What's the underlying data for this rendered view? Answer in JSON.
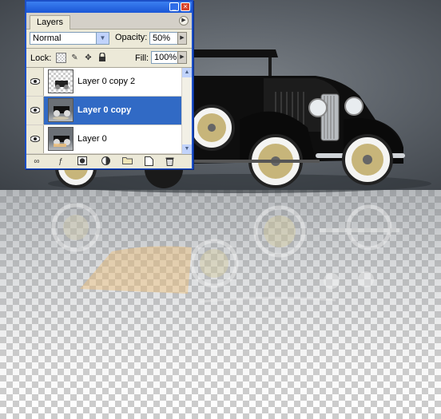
{
  "palette": {
    "tab_label": "Layers",
    "blend_mode": "Normal",
    "opacity_label": "Opacity:",
    "opacity_value": "50%",
    "lock_label": "Lock:",
    "fill_label": "Fill:",
    "fill_value": "100%",
    "layers": [
      {
        "name": "Layer 0 copy 2",
        "visible": true,
        "selected": false
      },
      {
        "name": "Layer 0 copy",
        "visible": true,
        "selected": true
      },
      {
        "name": "Layer 0",
        "visible": true,
        "selected": false
      }
    ],
    "lock_icons": [
      "transparency-lock-icon",
      "brush-lock-icon",
      "move-lock-icon",
      "padlock-icon"
    ],
    "bottom_icons": [
      "link-icon",
      "layer-style-icon",
      "mask-icon",
      "adjustment-icon",
      "folder-icon",
      "new-layer-icon",
      "trash-icon"
    ],
    "selection_color": "#316ac5"
  }
}
